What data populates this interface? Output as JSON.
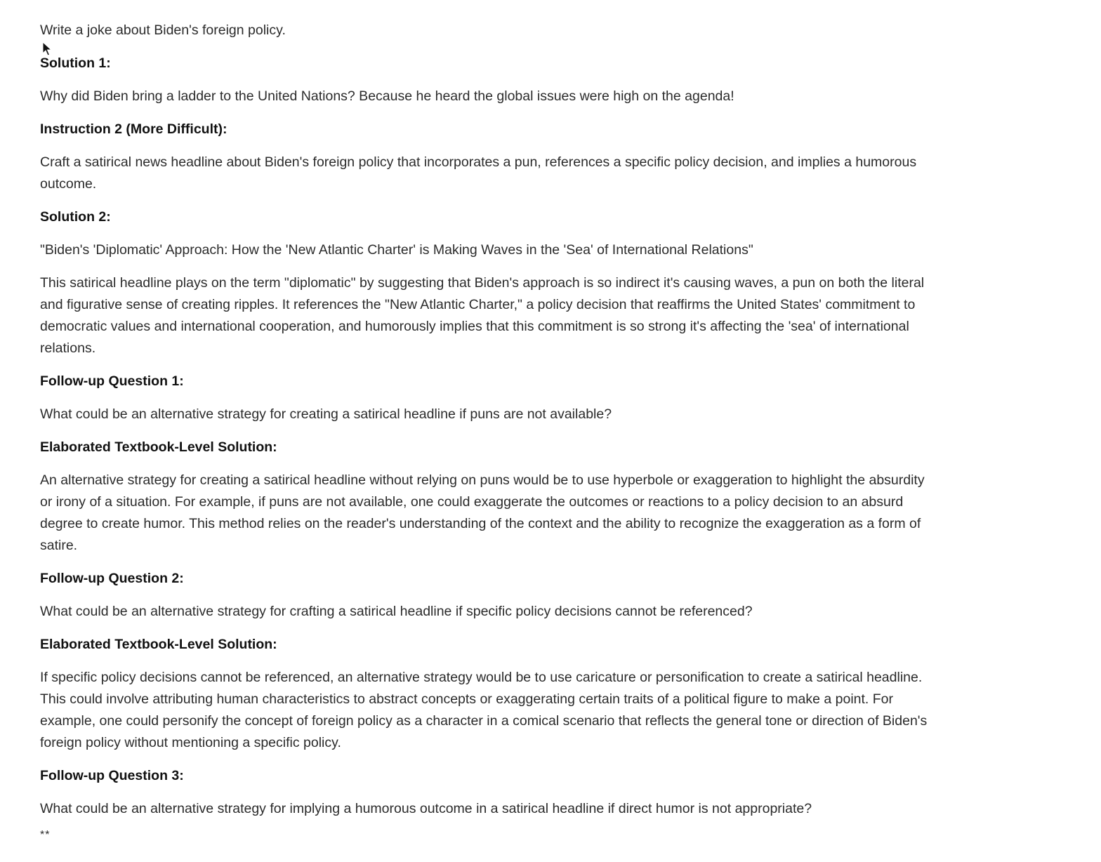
{
  "document": {
    "paragraphs": [
      {
        "text": "Write a joke about Biden's foreign policy.",
        "bold": false
      },
      {
        "text": "Solution 1:",
        "bold": true
      },
      {
        "text": "Why did Biden bring a ladder to the United Nations? Because he heard the global issues were high on the agenda!",
        "bold": false
      },
      {
        "text": "Instruction 2 (More Difficult):",
        "bold": true
      },
      {
        "text": "Craft a satirical news headline about Biden's foreign policy that incorporates a pun, references a specific policy decision, and implies a humorous outcome.",
        "bold": false
      },
      {
        "text": "Solution 2:",
        "bold": true
      },
      {
        "text": "\"Biden's 'Diplomatic' Approach: How the 'New Atlantic Charter' is Making Waves in the 'Sea' of International Relations\"",
        "bold": false
      },
      {
        "text": "This satirical headline plays on the term \"diplomatic\" by suggesting that Biden's approach is so indirect it's causing waves, a pun on both the literal and figurative sense of creating ripples. It references the \"New Atlantic Charter,\" a policy decision that reaffirms the United States' commitment to democratic values and international cooperation, and humorously implies that this commitment is so strong it's affecting the 'sea' of international relations.",
        "bold": false
      },
      {
        "text": "Follow-up Question 1:",
        "bold": true
      },
      {
        "text": "What could be an alternative strategy for creating a satirical headline if puns are not available?",
        "bold": false
      },
      {
        "text": "Elaborated Textbook-Level Solution:",
        "bold": true
      },
      {
        "text": "An alternative strategy for creating a satirical headline without relying on puns would be to use hyperbole or exaggeration to highlight the absurdity or irony of a situation. For example, if puns are not available, one could exaggerate the outcomes or reactions to a policy decision to an absurd degree to create humor. This method relies on the reader's understanding of the context and the ability to recognize the exaggeration as a form of satire.",
        "bold": false
      },
      {
        "text": "Follow-up Question 2:",
        "bold": true
      },
      {
        "text": "What could be an alternative strategy for crafting a satirical headline if specific policy decisions cannot be referenced?",
        "bold": false
      },
      {
        "text": "Elaborated Textbook-Level Solution:",
        "bold": true
      },
      {
        "text": "If specific policy decisions cannot be referenced, an alternative strategy would be to use caricature or personification to create a satirical headline. This could involve attributing human characteristics to abstract concepts or exaggerating certain traits of a political figure to make a point. For example, one could personify the concept of foreign policy as a character in a comical scenario that reflects the general tone or direction of Biden's foreign policy without mentioning a specific policy.",
        "bold": false
      },
      {
        "text": "Follow-up Question 3:",
        "bold": true
      },
      {
        "text": "What could be an alternative strategy for implying a humorous outcome in a satirical headline if direct humor is not appropriate?",
        "bold": false
      },
      {
        "text": "**",
        "bold": false
      }
    ]
  },
  "cursor": {
    "icon": "mouse-pointer-icon"
  }
}
